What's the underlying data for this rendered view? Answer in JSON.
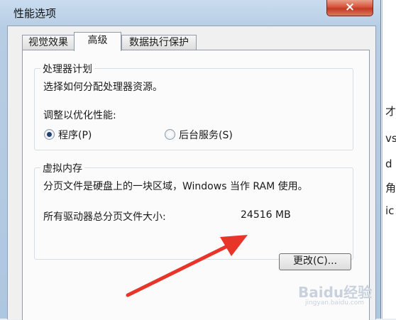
{
  "window": {
    "title": "性能选项",
    "close_glyph": "×"
  },
  "tabs": [
    {
      "label": "视觉效果",
      "active": false
    },
    {
      "label": "高级",
      "active": true
    },
    {
      "label": "数据执行保护",
      "active": false
    }
  ],
  "processor_scheduling": {
    "title": "处理器计划",
    "description": "选择如何分配处理器资源。",
    "adjust_label": "调整以优化性能:",
    "options": [
      {
        "label": "程序(P)",
        "selected": true
      },
      {
        "label": "后台服务(S)",
        "selected": false
      }
    ]
  },
  "virtual_memory": {
    "title": "虚拟内存",
    "description": "分页文件是硬盘上的一块区域，Windows 当作 RAM 使用。",
    "total_label": "所有驱动器总分页文件大小:",
    "total_value": "24516 MB",
    "change_button": "更改(C)..."
  },
  "annotation": {
    "arrow_color": "#e8352a"
  },
  "background_window": {
    "glyphs": [
      "才",
      "vs",
      "d",
      "角",
      "ic"
    ]
  },
  "watermark": {
    "text": "Baidu经验",
    "subtext": "jingyan.baidu.com"
  }
}
